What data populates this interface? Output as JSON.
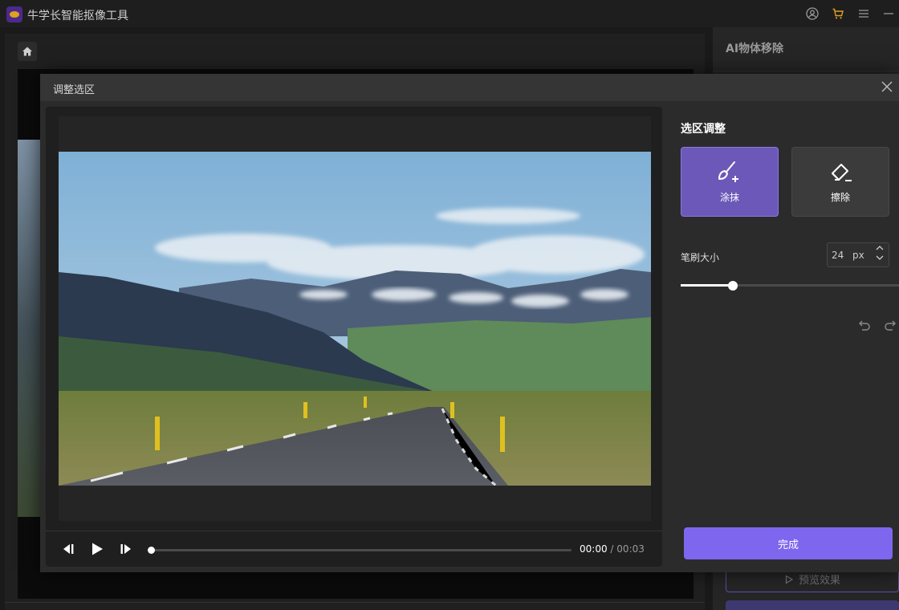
{
  "app": {
    "title": "牛学长智能抠像工具"
  },
  "right_panel": {
    "title": "AI物体移除",
    "preview_label": "预览效果"
  },
  "modal": {
    "title": "调整选区",
    "tools": {
      "title": "选区调整",
      "brush_label": "涂抹",
      "erase_label": "擦除",
      "brush_size_label": "笔刷大小",
      "brush_size_value": "24",
      "brush_size_unit": "px",
      "brush_size_fraction": 0.24
    },
    "player": {
      "current_time": "00:00",
      "separator": "/",
      "duration": "00:03",
      "progress": 0
    },
    "done_label": "完成"
  },
  "colors": {
    "accent": "#7f66ee",
    "active_tool": "#6b58b8",
    "background": "#1a1a1a"
  },
  "icons": {
    "titlebar": [
      "user-icon",
      "cart-icon",
      "menu-icon",
      "minimize-icon"
    ],
    "tools": [
      "brush-icon",
      "eraser-icon"
    ],
    "history": [
      "undo-icon",
      "redo-icon",
      "reset-icon"
    ]
  }
}
